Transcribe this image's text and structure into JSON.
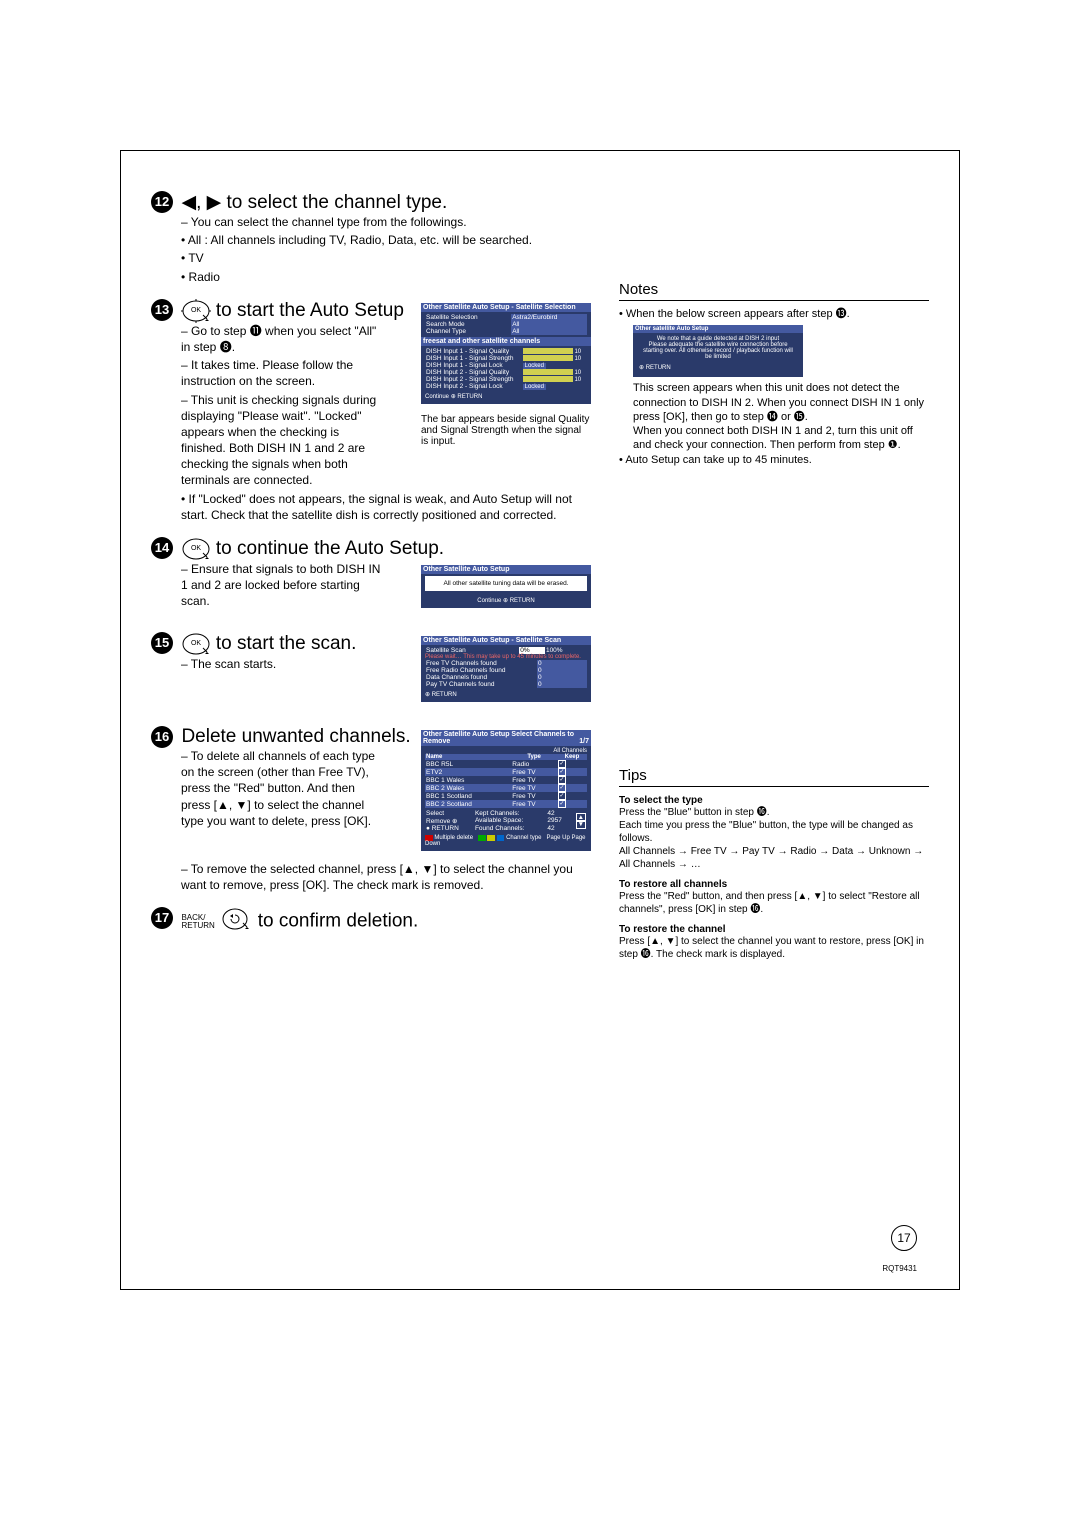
{
  "page_number": "17",
  "doc_id": "RQT9431",
  "step12": {
    "title": " ◀, ▶ to select the channel type.",
    "lines": [
      "You can select the channel type from the followings.",
      "All : All channels including TV, Radio, Data, etc. will be searched.",
      "TV",
      "Radio"
    ]
  },
  "step13": {
    "title": " to start the Auto Setup",
    "lines": [
      "Go to step ⓫ when you select \"All\" in step ❽.",
      "It takes time. Please follow the instruction on the screen.",
      "This unit is checking signals during displaying \"Please wait\". \"Locked\" appears when the checking is finished. Both DISH IN 1 and 2 are checking the signals when both terminals are connected.",
      "If \"Locked\" does not appears, the signal is weak, and Auto Setup will not start. Check that the satellite dish is correctly positioned and corrected."
    ],
    "osd_title": "Other Satellite Auto Setup - Satellite Selection",
    "osd": {
      "satellite_selection_label": "Satellite Selection",
      "satellite_selection_value": "Astra2/Eurobird",
      "search_mode_label": "Search Mode",
      "search_mode_value": "All",
      "channel_type_label": "Channel Type",
      "channel_type_value": "All",
      "sub_head": "freesat and other satellite channels",
      "rows": [
        {
          "l": "DISH Input 1 - Signal Quality",
          "v": "10"
        },
        {
          "l": "DISH Input 1 - Signal Strength",
          "v": "10"
        },
        {
          "l": "DISH Input 1 - Signal Lock",
          "v": "Locked"
        },
        {
          "l": "DISH Input 2 - Signal Quality",
          "v": "10"
        },
        {
          "l": "DISH Input 2 - Signal Strength",
          "v": "10"
        },
        {
          "l": "DISH Input 2 - Signal Lock",
          "v": "Locked"
        }
      ],
      "continue": "Continue",
      "return": "RETURN"
    },
    "caption": "The bar appears beside signal Quality and Signal Strength when the signal is input."
  },
  "step14": {
    "title": " to continue the Auto Setup.",
    "lines": [
      "Ensure that signals to both DISH IN 1 and 2 are locked before starting scan."
    ],
    "osd_title": "Other Satellite Auto Setup",
    "osd_msg": "All other satellite tuning data will be erased.",
    "continue": "Continue",
    "return": "RETURN"
  },
  "step15": {
    "title": " to start the scan.",
    "lines": [
      "The scan starts."
    ],
    "osd_title": "Other Satellite Auto Setup - Satellite Scan",
    "scan_label": "Satellite Scan",
    "scan_pct": "0%",
    "scan_max": "100%",
    "scan_msg": "Please wait… This may take up to 45 minutes to complete.",
    "rows": [
      {
        "l": "Free TV Channels found",
        "v": "0"
      },
      {
        "l": "Free Radio Channels found",
        "v": "0"
      },
      {
        "l": "Data Channels found",
        "v": "0"
      },
      {
        "l": "Pay TV Channels found",
        "v": "0"
      }
    ],
    "return": "RETURN"
  },
  "step16": {
    "title": "Delete unwanted channels.",
    "lines": [
      "To delete all channels of each type on the screen (other than Free TV), press the \"Red\" button. And then press [▲, ▼] to select the channel type you want to delete, press [OK].",
      "To remove the selected channel, press [▲, ▼] to select the channel you want to remove, press [OK]. The check mark is removed."
    ],
    "osd_title": "Other Satellite Auto Setup   Select Channels to Remove",
    "pos": "1/7",
    "all": "All Channels",
    "headers": {
      "name": "Name",
      "type": "Type",
      "keep": "Keep"
    },
    "rows": [
      {
        "n": "BBC R5L",
        "t": "Radio"
      },
      {
        "n": "ETV2",
        "t": "Free TV"
      },
      {
        "n": "BBC 1 Wales",
        "t": "Free TV"
      },
      {
        "n": "BBC 2 Wales",
        "t": "Free TV"
      },
      {
        "n": "BBC 1 Scotland",
        "t": "Free TV"
      },
      {
        "n": "BBC 2 Scotland",
        "t": "Free TV"
      }
    ],
    "foot": {
      "select": "Select",
      "remove": "Remove",
      "return": "RETURN",
      "kept_l": "Kept Channels:",
      "kept_v": "42",
      "space_l": "Available Space:",
      "space_v": "2957",
      "found_l": "Found Channels:",
      "found_v": "42",
      "pgup": "Page Up",
      "pgdn": "Page Down",
      "multiple": "Multiple delete",
      "chtype": "Channel type"
    }
  },
  "step17": {
    "back_label": "BACK/\nRETURN",
    "title": " to confirm deletion."
  },
  "notes": {
    "heading": "Notes",
    "p1": "When the below screen appears after step ⓭.",
    "box_title": "Other satellite Auto Setup",
    "box_l1": "We note that a guide detected at DISH 2 input",
    "box_l2": "Please adequate the satellite wire connection before starting over. All otherwise record / playback function will be limited",
    "box_ret": "RETURN",
    "p2": "This screen appears when this unit does not detect the connection to DISH IN 2. When you connect DISH IN 1 only press [OK], then go to step ⓮ or ⓯.\nWhen you connect both DISH IN 1 and 2, turn this unit off and check your connection. Then perform from step ❶.",
    "p3": "Auto Setup can take up to 45 minutes."
  },
  "tips": {
    "heading": "Tips",
    "t1_h": "To select the type",
    "t1_p": "Press the \"Blue\" button in step ⓰.\nEach time you press the \"Blue\" button, the type will be changed as follows.\nAll Channels → Free TV → Pay TV → Radio → Data → Unknown → All Channels → …",
    "t2_h": "To restore all channels",
    "t2_p": "Press the \"Red\" button, and then press [▲, ▼] to select \"Restore all channels\", press [OK] in step ⓰.",
    "t3_h": "To restore the channel",
    "t3_p": "Press [▲, ▼] to select the channel you want to restore, press [OK] in step ⓰. The check mark is displayed."
  }
}
